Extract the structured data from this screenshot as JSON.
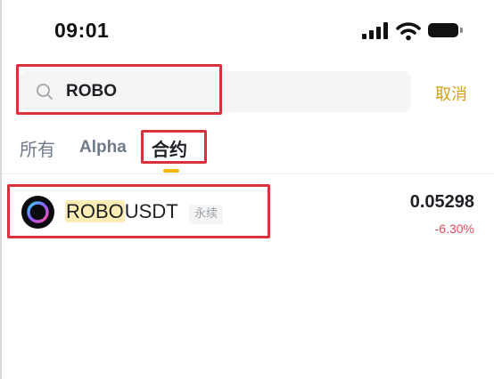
{
  "status_bar": {
    "time": "09:01"
  },
  "search": {
    "query": "ROBO",
    "cancel_label": "取消"
  },
  "tabs": [
    {
      "label": "所有",
      "selected": false
    },
    {
      "label": "Alpha",
      "selected": false
    },
    {
      "label": "合约",
      "selected": true
    }
  ],
  "results": [
    {
      "symbol_match": "ROBO",
      "symbol_rest": "USDT",
      "badge": "永续",
      "price": "0.05298",
      "change": "-6.30%",
      "icon": "robo-coin-icon"
    }
  ],
  "colors": {
    "accent": "#f0b90b",
    "cancel": "#d4a20c",
    "negative": "#e64a5c",
    "highlight_box": "#d8323c",
    "match_highlight": "#fcedb5"
  }
}
